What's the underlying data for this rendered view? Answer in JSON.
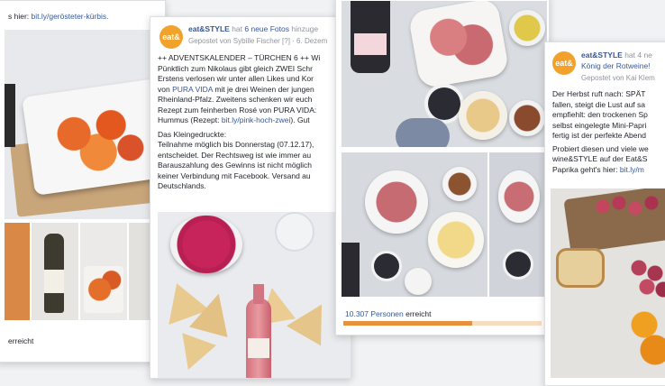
{
  "card1": {
    "link_prefix": "s hier: ",
    "link": "bit.ly/gerösteter-kürbis.",
    "footer": "erreicht"
  },
  "card2": {
    "avatar_text": "eat&",
    "page_name": "eat&STYLE",
    "action": " hat ",
    "action_link": "6 neue Fotos",
    "action_suffix": " hinzuge",
    "posted_by": "Gepostet von Sybille Fischer [?] · 6. Dezem",
    "p1": "++ ADVENTSKALENDER – TÜRCHEN 6 ++ Wi",
    "p2": "Pünktlich zum Nikolaus gibt gleich ZWEI Schr",
    "p3": "Erstens verlosen wir unter allen Likes und Kor",
    "p4_pre": "von ",
    "p4_link": "PURA VIDA",
    "p4_post": " mit je drei Weinen der jungen",
    "p5": "Rheinland-Pfalz. Zweitens schenken wir euch",
    "p6": "Rezept zum feinherben Rosé von PURA VIDA:",
    "p7_pre": "Hummus (Rezept: ",
    "p7_link": "bit.ly/pink-hoch-zwei",
    "p7_post": "). Gut",
    "fine_title": "Das Kleingedruckte:",
    "f1": "Teilnahme möglich bis Donnerstag (07.12.17),",
    "f2": "entscheidet. Der Rechtsweg ist wie immer au",
    "f3": "Barauszahlung des Gewinns ist nicht möglich",
    "f4": "keiner Verbindung mit Facebook. Versand au",
    "f5": "Deutschlands."
  },
  "card3": {
    "reach_count": "10.307 Personen",
    "reach_suffix": " erreicht",
    "reach_fraction": 0.65
  },
  "card4": {
    "avatar_text": "eat&",
    "page_name": "eat&STYLE",
    "action": " hat 4 ne",
    "title_link": "König der Rotweine!",
    "posted_by": "Gepostet von Kai Klem",
    "p1": "Der Herbst ruft nach: SPÄT",
    "p2": "fallen, steigt die Lust auf sa",
    "p3": "empfiehlt: den trockenen Sp",
    "p4": "selbst eingelegte Mini-Papri",
    "p5": "fertig ist der perfekte Abend",
    "p6": "Probiert diesen und viele we",
    "p7": "wine&STYLE auf der Eat&S",
    "p8_pre": "Paprika geht's hier: ",
    "p8_link": "bit.ly/m"
  },
  "colors": {
    "link": "#365899",
    "accent_orange": "#f2a12b",
    "reach_bar": "#e9913a"
  }
}
